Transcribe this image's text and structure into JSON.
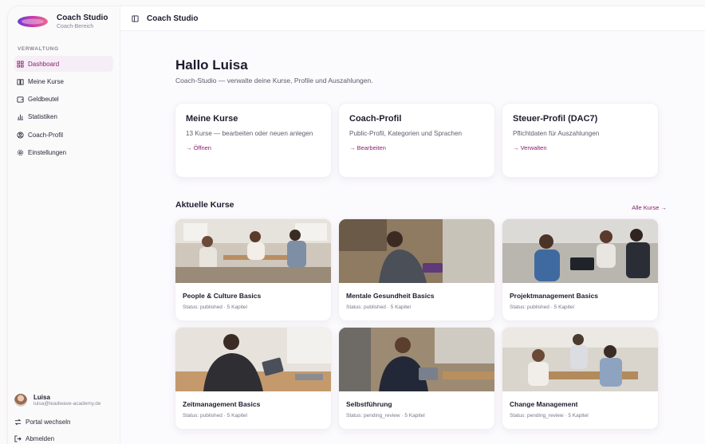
{
  "brand": {
    "title": "Coach Studio",
    "subtitle": "Coach-Bereich"
  },
  "sidebar": {
    "section_label": "VERWALTUNG",
    "items": [
      {
        "label": "Dashboard",
        "icon": "grid-icon",
        "active": true
      },
      {
        "label": "Meine Kurse",
        "icon": "book-icon",
        "active": false
      },
      {
        "label": "Geldbeutel",
        "icon": "wallet-icon",
        "active": false
      },
      {
        "label": "Statistiken",
        "icon": "bar-chart-icon",
        "active": false
      },
      {
        "label": "Coach-Profil",
        "icon": "user-circle-icon",
        "active": false
      },
      {
        "label": "Einstellungen",
        "icon": "gear-icon",
        "active": false
      }
    ],
    "user": {
      "name": "Luisa",
      "email": "luisa@leadwave-academy.de"
    },
    "switch_portal": "Portal wechseln",
    "logout": "Abmelden"
  },
  "topbar": {
    "title": "Coach Studio"
  },
  "main": {
    "greeting": "Hallo Luisa",
    "subtitle": "Coach-Studio — verwalte deine Kurse, Profile und Auszahlungen.",
    "cards": [
      {
        "title": "Meine Kurse",
        "desc": "13 Kurse — bearbeiten oder neuen anlegen",
        "link": "→ Öffnen"
      },
      {
        "title": "Coach-Profil",
        "desc": "Public-Profil, Kategorien und Sprachen",
        "link": "→ Bearbeiten"
      },
      {
        "title": "Steuer-Profil (DAC7)",
        "desc": "Pflichtdaten für Auszahlungen",
        "link": "→ Verwalten"
      }
    ],
    "section_title": "Aktuelle Kurse",
    "all_link": "Alle Kurse →",
    "courses": [
      {
        "title": "People & Culture Basics",
        "status": "Status: published · 5 Kapitel"
      },
      {
        "title": "Mentale Gesundheit Basics",
        "status": "Status: published · 5 Kapitel"
      },
      {
        "title": "Projektmanagement Basics",
        "status": "Status: published · 5 Kapitel"
      },
      {
        "title": "Zeitmanagement Basics",
        "status": "Status: published · 5 Kapitel"
      },
      {
        "title": "Selbstführung",
        "status": "Status: pending_review · 5 Kapitel"
      },
      {
        "title": "Change Management",
        "status": "Status: pending_review · 5 Kapitel"
      }
    ]
  },
  "colors": {
    "accent": "#8a1f6e",
    "active_bg": "#f6eef6",
    "text": "#1f1b2d",
    "muted": "#5f5a6d"
  }
}
